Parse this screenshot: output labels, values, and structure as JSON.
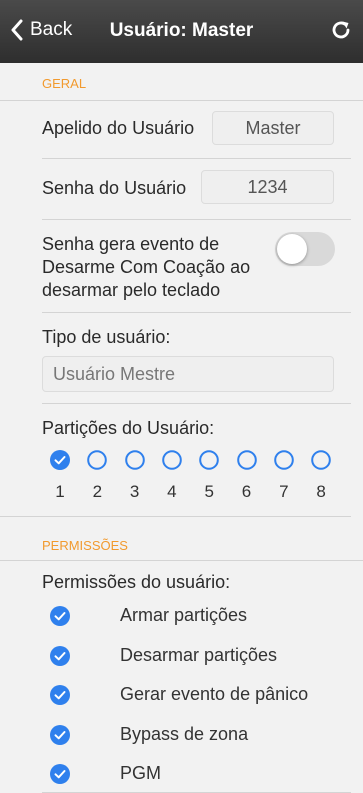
{
  "navbar": {
    "back_label": "Back",
    "title": "Usuário: Master",
    "refresh_icon": "refresh-icon"
  },
  "geral": {
    "header": "GERAL",
    "apelido_label": "Apelido do Usuário",
    "apelido_value": "Master",
    "senha_label": "Senha do Usuário",
    "senha_value": "1234",
    "coacao_label_1": "Senha gera evento de",
    "coacao_label_2": "Desarme Com Coação ao",
    "coacao_label_3": "desarmar pelo teclado",
    "coacao_enabled": false,
    "tipo_label": "Tipo de usuário:",
    "tipo_value": "Usuário Mestre",
    "particoes_label": "Partições do Usuário:",
    "particoes": [
      {
        "num": "1",
        "checked": true
      },
      {
        "num": "2",
        "checked": false
      },
      {
        "num": "3",
        "checked": false
      },
      {
        "num": "4",
        "checked": false
      },
      {
        "num": "5",
        "checked": false
      },
      {
        "num": "6",
        "checked": false
      },
      {
        "num": "7",
        "checked": false
      },
      {
        "num": "8",
        "checked": false
      }
    ]
  },
  "permissoes": {
    "header": "PERMISSÕES",
    "label": "Permissões do usuário:",
    "items": [
      {
        "label": "Armar partições",
        "checked": true
      },
      {
        "label": "Desarmar partições",
        "checked": true
      },
      {
        "label": "Gerar evento de pânico",
        "checked": true
      },
      {
        "label": "Bypass de zona",
        "checked": true
      },
      {
        "label": "PGM",
        "checked": true
      }
    ]
  },
  "colors": {
    "accent_blue": "#2f80ed",
    "section_orange": "#f29a2e"
  }
}
